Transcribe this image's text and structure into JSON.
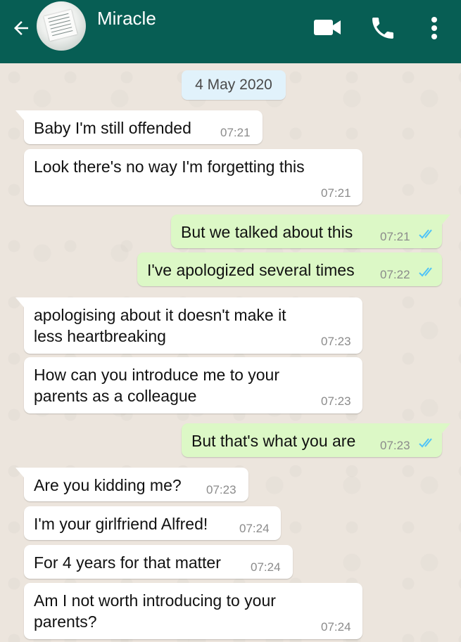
{
  "header": {
    "contact_name": "Miracle",
    "back_icon": "arrow-left-icon",
    "video_icon": "videocam-icon",
    "call_icon": "phone-icon",
    "menu_icon": "more-vert-icon",
    "color": "#075e54"
  },
  "date_chip": "4 May 2020",
  "colors": {
    "incoming": "#ffffff",
    "outgoing": "#dcf8c6",
    "read_ticks": "#4fc3f7"
  },
  "messages": [
    {
      "direction": "in",
      "text": "Baby I'm still offended",
      "time": "07:21"
    },
    {
      "direction": "in",
      "text": "Look there's no way I'm forgetting this",
      "time": "07:21"
    },
    {
      "direction": "out",
      "text": "But we talked about this",
      "time": "07:21",
      "status": "read"
    },
    {
      "direction": "out",
      "text": "I've apologized several times",
      "time": "07:22",
      "status": "read"
    },
    {
      "direction": "in",
      "text": "apologising about it doesn't make it less heartbreaking",
      "time": "07:23"
    },
    {
      "direction": "in",
      "text": "How can you introduce me to your parents as a colleague",
      "time": "07:23"
    },
    {
      "direction": "out",
      "text": "But that's what you are",
      "time": "07:23",
      "status": "read"
    },
    {
      "direction": "in",
      "text": "Are you kidding me?",
      "time": "07:23"
    },
    {
      "direction": "in",
      "text": "I'm your girlfriend Alfred!",
      "time": "07:24"
    },
    {
      "direction": "in",
      "text": "For 4 years for that matter",
      "time": "07:24"
    },
    {
      "direction": "in",
      "text": "Am I not worth introducing to your parents?",
      "time": "07:24"
    }
  ]
}
